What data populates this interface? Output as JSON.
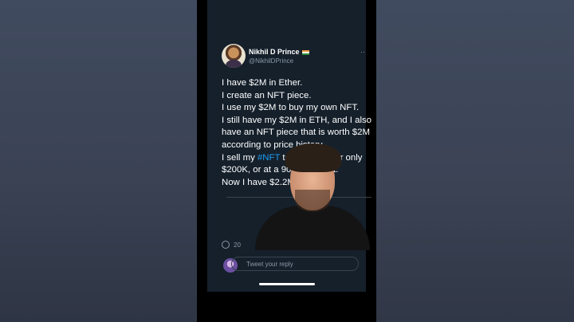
{
  "tweet": {
    "author_name": "Nikhil D Prince",
    "author_handle": "@NikhilDPrince",
    "lines": [
      "I have $2M in Ether.",
      "I create an NFT piece.",
      "I use my $2M to buy my own NFT.",
      "I still have my $2M in ETH, and I also",
      "have an NFT piece that is worth $2M",
      "according to price history.",
      "I sell my #NFT to someone for only",
      "$200K, or at a 90% discount.",
      "Now I have $2.2M"
    ],
    "line7_pre": "I sell my ",
    "hashtag": "#NFT",
    "line7_post": " to someone for only",
    "hashtag_color": "#1d9bf0"
  },
  "actions": {
    "comment_count": "20"
  },
  "reply": {
    "placeholder": "Tweet your reply"
  },
  "icons": {
    "flag": "india-flag-icon",
    "more": "more-options-icon",
    "comment": "comment-icon"
  }
}
